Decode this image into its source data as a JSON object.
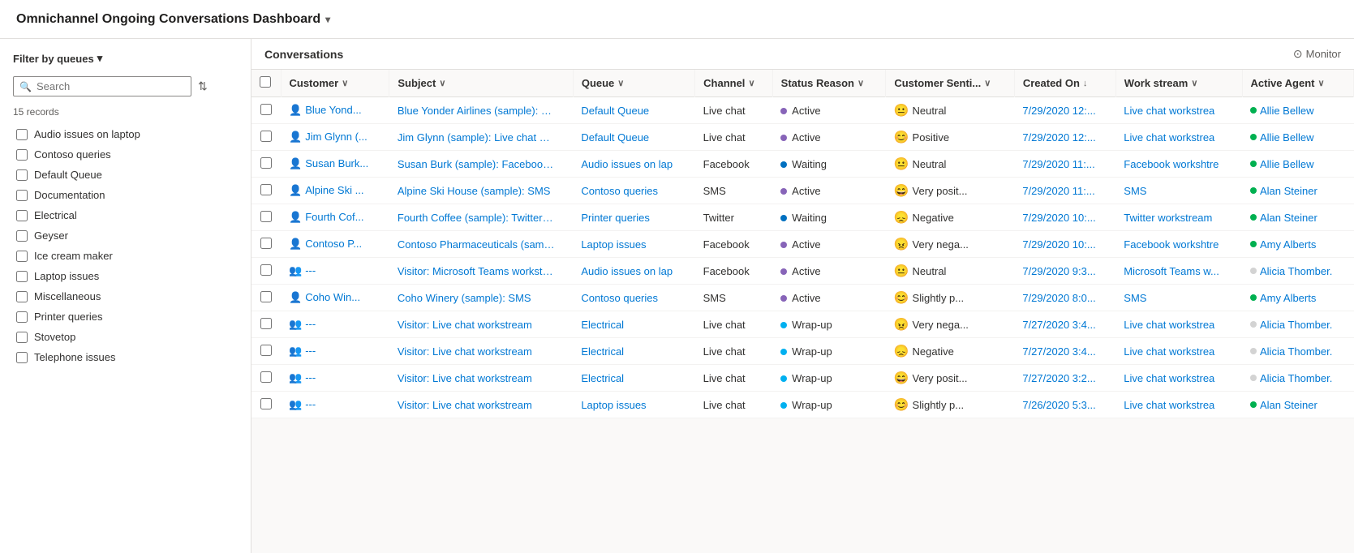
{
  "header": {
    "title": "Omnichannel Ongoing Conversations Dashboard",
    "chevron": "▾"
  },
  "sidebar": {
    "filter_label": "Filter by queues",
    "filter_chevron": "▾",
    "search_placeholder": "Search",
    "records_count": "15 records",
    "queues": [
      {
        "id": "audio-issues",
        "label": "Audio issues on laptop",
        "checked": false
      },
      {
        "id": "contoso-queries",
        "label": "Contoso queries",
        "checked": false
      },
      {
        "id": "default-queue",
        "label": "Default Queue",
        "checked": false
      },
      {
        "id": "documentation",
        "label": "Documentation",
        "checked": false
      },
      {
        "id": "electrical",
        "label": "Electrical",
        "checked": false
      },
      {
        "id": "geyser",
        "label": "Geyser",
        "checked": false
      },
      {
        "id": "ice-cream-maker",
        "label": "Ice cream maker",
        "checked": false
      },
      {
        "id": "laptop-issues",
        "label": "Laptop issues",
        "checked": false
      },
      {
        "id": "miscellaneous",
        "label": "Miscellaneous",
        "checked": false
      },
      {
        "id": "printer-queries",
        "label": "Printer queries",
        "checked": false
      },
      {
        "id": "stovetop",
        "label": "Stovetop",
        "checked": false
      },
      {
        "id": "telephone-issues",
        "label": "Telephone issues",
        "checked": false
      }
    ]
  },
  "conversations": {
    "title": "Conversations",
    "monitor_label": "Monitor",
    "columns": [
      {
        "key": "check",
        "label": ""
      },
      {
        "key": "customer",
        "label": "Customer",
        "sortable": true
      },
      {
        "key": "subject",
        "label": "Subject",
        "sortable": true
      },
      {
        "key": "queue",
        "label": "Queue",
        "sortable": true
      },
      {
        "key": "channel",
        "label": "Channel",
        "sortable": true
      },
      {
        "key": "status_reason",
        "label": "Status Reason",
        "sortable": true
      },
      {
        "key": "customer_senti",
        "label": "Customer Senti...",
        "sortable": true
      },
      {
        "key": "created_on",
        "label": "Created On",
        "sortable": true,
        "sorted": true
      },
      {
        "key": "work_stream",
        "label": "Work stream",
        "sortable": true
      },
      {
        "key": "active_agent",
        "label": "Active Agent",
        "sortable": true
      }
    ],
    "rows": [
      {
        "customer_icon": "person",
        "customer": "Blue Yond...",
        "subject": "Blue Yonder Airlines (sample): Live c...",
        "queue": "Default Queue",
        "channel": "Live chat",
        "status_dot_color": "#8764b8",
        "status_reason": "Active",
        "sentiment_emoji": "😐",
        "sentiment": "Neutral",
        "created_on": "7/29/2020 12:...",
        "work_stream": "Live chat workstrea",
        "agent_dot_color": "#00b050",
        "active_agent": "Allie Bellew"
      },
      {
        "customer_icon": "person",
        "customer": "Jim Glynn (...",
        "subject": "Jim Glynn (sample): Live chat works",
        "queue": "Default Queue",
        "channel": "Live chat",
        "status_dot_color": "#8764b8",
        "status_reason": "Active",
        "sentiment_emoji": "😊",
        "sentiment": "Positive",
        "created_on": "7/29/2020 12:...",
        "work_stream": "Live chat workstrea",
        "agent_dot_color": "#00b050",
        "active_agent": "Allie Bellew"
      },
      {
        "customer_icon": "person",
        "customer": "Susan Burk...",
        "subject": "Susan Burk (sample): Facebook wor",
        "queue": "Audio issues on lap",
        "channel": "Facebook",
        "status_dot_color": "#0070c0",
        "status_reason": "Waiting",
        "sentiment_emoji": "😐",
        "sentiment": "Neutral",
        "created_on": "7/29/2020 11:...",
        "work_stream": "Facebook workshtre",
        "agent_dot_color": "#00b050",
        "active_agent": "Allie Bellew"
      },
      {
        "customer_icon": "person",
        "customer": "Alpine Ski ...",
        "subject": "Alpine Ski House (sample): SMS",
        "queue": "Contoso queries",
        "channel": "SMS",
        "status_dot_color": "#8764b8",
        "status_reason": "Active",
        "sentiment_emoji": "😄",
        "sentiment": "Very posit...",
        "created_on": "7/29/2020 11:...",
        "work_stream": "SMS",
        "agent_dot_color": "#00b050",
        "active_agent": "Alan Steiner"
      },
      {
        "customer_icon": "person",
        "customer": "Fourth Cof...",
        "subject": "Fourth Coffee (sample): Twitter wor",
        "queue": "Printer queries",
        "channel": "Twitter",
        "status_dot_color": "#0070c0",
        "status_reason": "Waiting",
        "sentiment_emoji": "😞",
        "sentiment": "Negative",
        "created_on": "7/29/2020 10:...",
        "work_stream": "Twitter workstream",
        "agent_dot_color": "#00b050",
        "active_agent": "Alan Steiner"
      },
      {
        "customer_icon": "person",
        "customer": "Contoso P...",
        "subject": "Contoso Pharmaceuticals (sample):",
        "queue": "Laptop issues",
        "channel": "Facebook",
        "status_dot_color": "#8764b8",
        "status_reason": "Active",
        "sentiment_emoji": "😠",
        "sentiment": "Very nega...",
        "created_on": "7/29/2020 10:...",
        "work_stream": "Facebook workshtre",
        "agent_dot_color": "#00b050",
        "active_agent": "Amy Alberts"
      },
      {
        "customer_icon": "group",
        "customer": "---",
        "subject": "Visitor: Microsoft Teams workstrean",
        "queue": "Audio issues on lap",
        "channel": "Facebook",
        "status_dot_color": "#8764b8",
        "status_reason": "Active",
        "sentiment_emoji": "😐",
        "sentiment": "Neutral",
        "created_on": "7/29/2020 9:3...",
        "work_stream": "Microsoft Teams w...",
        "agent_dot_color": "#d3d3d3",
        "active_agent": "Alicia Thomber."
      },
      {
        "customer_icon": "person",
        "customer": "Coho Win...",
        "subject": "Coho Winery (sample): SMS",
        "queue": "Contoso queries",
        "channel": "SMS",
        "status_dot_color": "#8764b8",
        "status_reason": "Active",
        "sentiment_emoji": "😊",
        "sentiment": "Slightly p...",
        "created_on": "7/29/2020 8:0...",
        "work_stream": "SMS",
        "agent_dot_color": "#00b050",
        "active_agent": "Amy Alberts"
      },
      {
        "customer_icon": "group",
        "customer": "---",
        "subject": "Visitor: Live chat workstream",
        "queue": "Electrical",
        "channel": "Live chat",
        "status_dot_color": "#00b0f0",
        "status_reason": "Wrap-up",
        "sentiment_emoji": "😠",
        "sentiment": "Very nega...",
        "created_on": "7/27/2020 3:4...",
        "work_stream": "Live chat workstrea",
        "agent_dot_color": "#d3d3d3",
        "active_agent": "Alicia Thomber."
      },
      {
        "customer_icon": "group",
        "customer": "---",
        "subject": "Visitor: Live chat workstream",
        "queue": "Electrical",
        "channel": "Live chat",
        "status_dot_color": "#00b0f0",
        "status_reason": "Wrap-up",
        "sentiment_emoji": "😞",
        "sentiment": "Negative",
        "created_on": "7/27/2020 3:4...",
        "work_stream": "Live chat workstrea",
        "agent_dot_color": "#d3d3d3",
        "active_agent": "Alicia Thomber."
      },
      {
        "customer_icon": "group",
        "customer": "---",
        "subject": "Visitor: Live chat workstream",
        "queue": "Electrical",
        "channel": "Live chat",
        "status_dot_color": "#00b0f0",
        "status_reason": "Wrap-up",
        "sentiment_emoji": "😄",
        "sentiment": "Very posit...",
        "created_on": "7/27/2020 3:2...",
        "work_stream": "Live chat workstrea",
        "agent_dot_color": "#d3d3d3",
        "active_agent": "Alicia Thomber."
      },
      {
        "customer_icon": "group",
        "customer": "---",
        "subject": "Visitor: Live chat workstream",
        "queue": "Laptop issues",
        "channel": "Live chat",
        "status_dot_color": "#00b0f0",
        "status_reason": "Wrap-up",
        "sentiment_emoji": "😊",
        "sentiment": "Slightly p...",
        "created_on": "7/26/2020 5:3...",
        "work_stream": "Live chat workstrea",
        "agent_dot_color": "#00b050",
        "active_agent": "Alan Steiner"
      }
    ]
  }
}
